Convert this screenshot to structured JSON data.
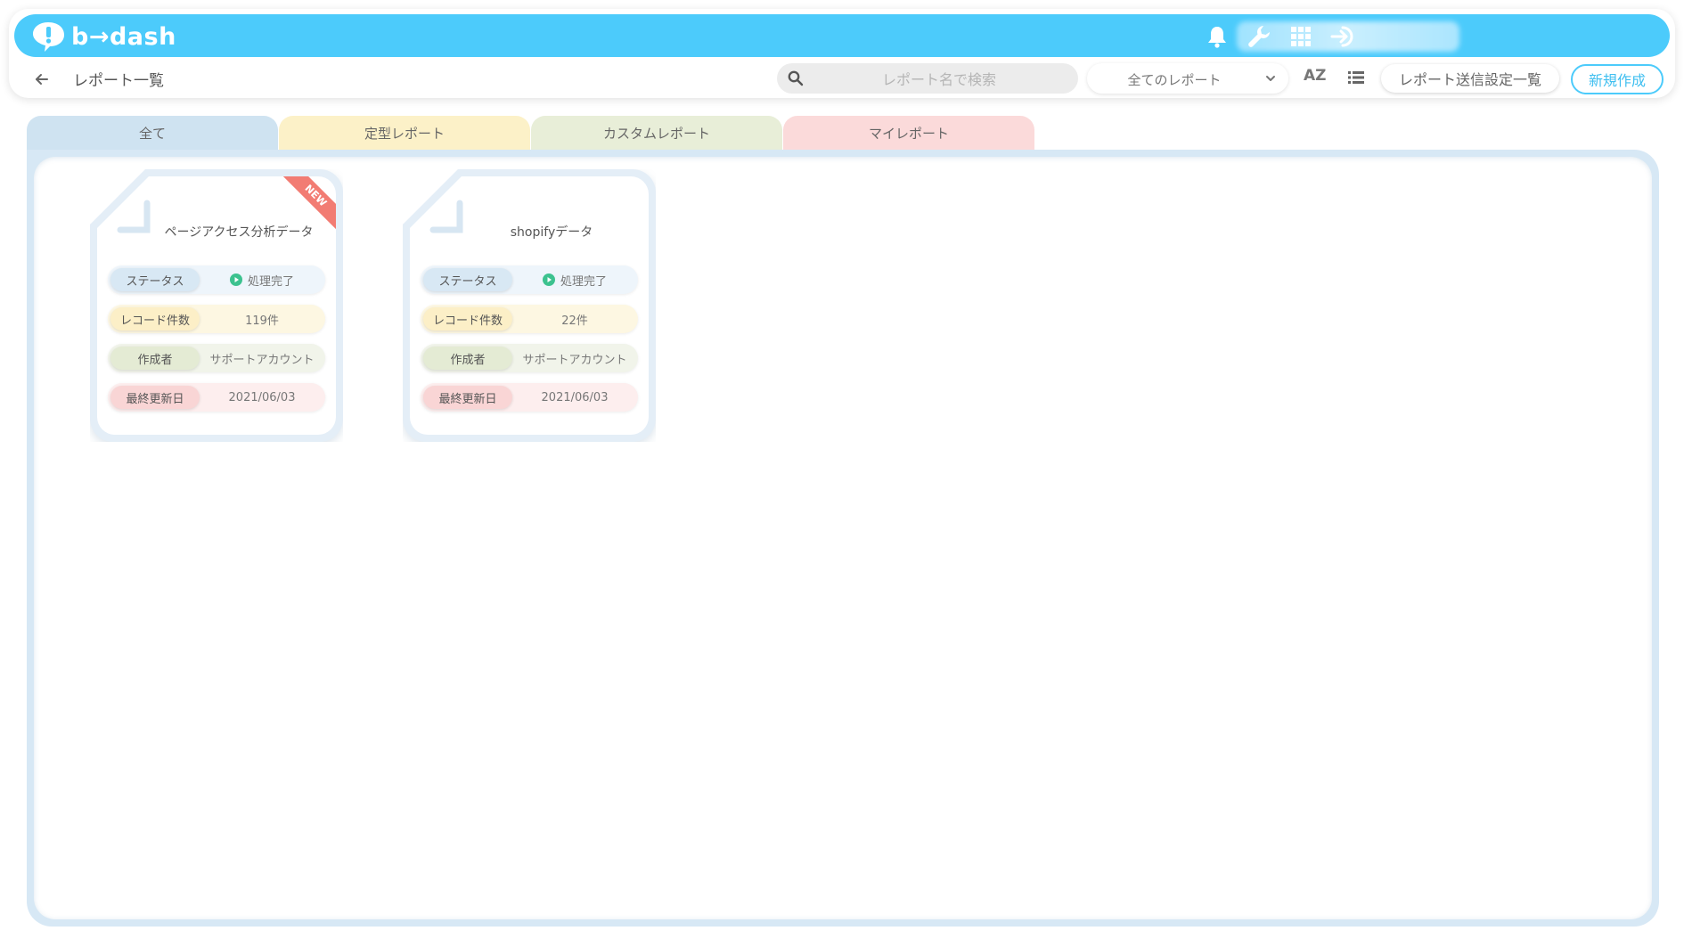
{
  "header": {
    "logo_text": "b→dash"
  },
  "subbar": {
    "title": "レポート一覧",
    "search_placeholder": "レポート名で検索",
    "filter_value": "全てのレポート",
    "sort_label": "AZ",
    "send_settings_label": "レポート送信設定一覧",
    "create_label": "新規作成"
  },
  "tabs": [
    {
      "label": "全て"
    },
    {
      "label": "定型レポート"
    },
    {
      "label": "カスタムレポート"
    },
    {
      "label": "マイレポート"
    }
  ],
  "colors": {
    "brand": "#4ccbfb",
    "status_green": "#3cc28f",
    "new_badge": "#f27c73"
  },
  "cards": [
    {
      "title": "ページアクセス分析データ",
      "badge": "NEW",
      "status_label": "ステータス",
      "status_value": "処理完了",
      "records_label": "レコード件数",
      "records_value": "119件",
      "author_label": "作成者",
      "author_value": "サポートアカウント",
      "updated_label": "最終更新日",
      "updated_value": "2021/06/03"
    },
    {
      "title": "shopifyデータ",
      "status_label": "ステータス",
      "status_value": "処理完了",
      "records_label": "レコード件数",
      "records_value": "22件",
      "author_label": "作成者",
      "author_value": "サポートアカウント",
      "updated_label": "最終更新日",
      "updated_value": "2021/06/03"
    }
  ]
}
